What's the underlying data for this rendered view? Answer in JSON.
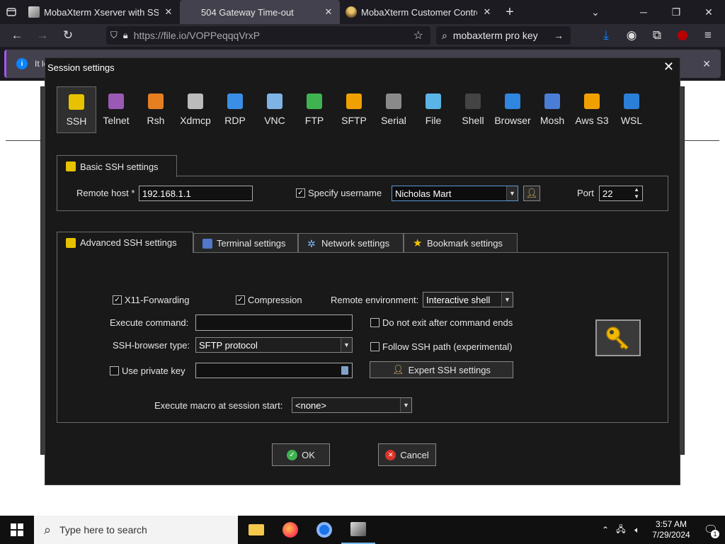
{
  "browser": {
    "tabs": [
      {
        "title": "MobaXterm Xserver with SSH, te",
        "active": false
      },
      {
        "title": "504 Gateway Time-out",
        "active": true
      },
      {
        "title": "MobaXterm Customer Control C",
        "active": false
      }
    ],
    "url": "https://file.io/VOPPeqqqVrxP",
    "search_text": "mobaxterm pro key",
    "notification_text": "It lo"
  },
  "dialog": {
    "title": "Session settings",
    "protocols": [
      "SSH",
      "Telnet",
      "Rsh",
      "Xdmcp",
      "RDP",
      "VNC",
      "FTP",
      "SFTP",
      "Serial",
      "File",
      "Shell",
      "Browser",
      "Mosh",
      "Aws S3",
      "WSL"
    ],
    "selected_protocol": "SSH",
    "basic": {
      "tab_label": "Basic SSH settings",
      "remote_host_label": "Remote host *",
      "remote_host_value": "192.168.1.1",
      "specify_username_label": "Specify username",
      "username_value": "Nicholas Mart",
      "port_label": "Port",
      "port_value": "22"
    },
    "tabs": [
      "Advanced SSH settings",
      "Terminal settings",
      "Network settings",
      "Bookmark settings"
    ],
    "advanced": {
      "x11_label": "X11-Forwarding",
      "compression_label": "Compression",
      "remote_env_label": "Remote environment:",
      "remote_env_value": "Interactive shell",
      "execute_command_label": "Execute command:",
      "do_not_exit_label": "Do not exit after command ends",
      "browser_type_label": "SSH-browser type:",
      "browser_type_value": "SFTP protocol",
      "follow_path_label": "Follow SSH path (experimental)",
      "private_key_label": "Use private key",
      "expert_button": "Expert SSH settings",
      "macro_label": "Execute macro at session start:",
      "macro_value": "<none>"
    },
    "ok_label": "OK",
    "cancel_label": "Cancel"
  },
  "taskbar": {
    "search_placeholder": "Type here to search",
    "time": "3:57 AM",
    "date": "7/29/2024",
    "notification_count": "1"
  }
}
